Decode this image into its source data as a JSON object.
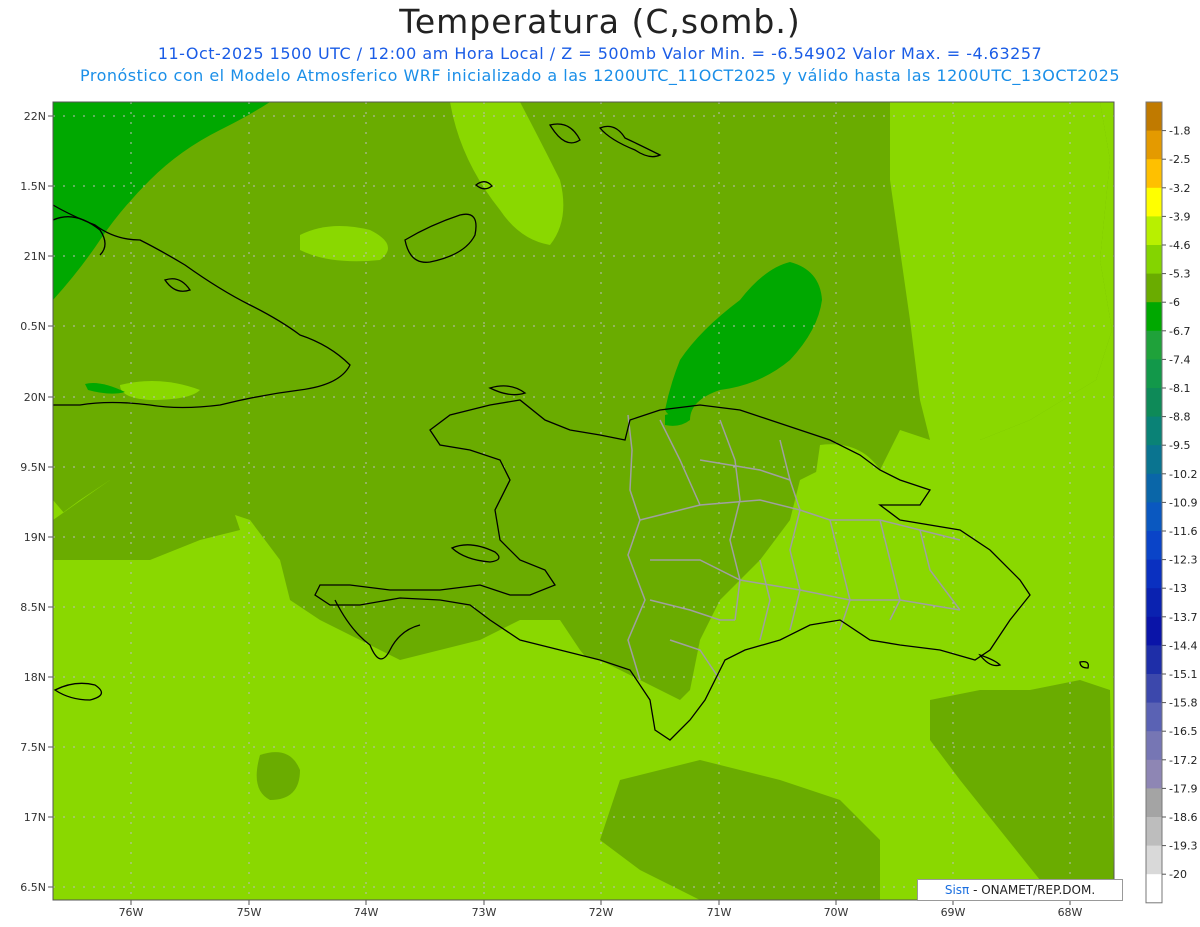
{
  "header": {
    "title": "Temperatura (C,somb.)",
    "line1": "11-Oct-2025  1500 UTC / 12:00 am Hora Local / Z = 500mb  Valor Min. = -6.54902  Valor Max. = -4.63257",
    "line2": "Pronóstico con el Modelo Atmosferico WRF inicializado a las 1200UTC_11OCT2025 y válido hasta las  1200UTC_13OCT2025"
  },
  "axes": {
    "lat_labels": [
      "22N",
      "1.5N",
      "21N",
      "0.5N",
      "20N",
      "9.5N",
      "19N",
      "8.5N",
      "18N",
      "7.5N",
      "17N",
      "6.5N"
    ],
    "lon_labels": [
      "76W",
      "75W",
      "74W",
      "73W",
      "72W",
      "71W",
      "70W",
      "69W",
      "68W"
    ]
  },
  "colorbar": {
    "labels": [
      "-1.8",
      "-2.5",
      "-3.2",
      "-3.9",
      "-4.6",
      "-5.3",
      "-6",
      "-6.7",
      "-7.4",
      "-8.1",
      "-8.8",
      "-9.5",
      "-10.2",
      "-10.9",
      "-11.6",
      "-12.3",
      "-13",
      "-13.7",
      "-14.4",
      "-15.1",
      "-15.8",
      "-16.5",
      "-17.2",
      "-17.9",
      "-18.6",
      "-19.3",
      "-20"
    ],
    "colors": [
      "#c07a00",
      "#e49a00",
      "#ffc000",
      "#ffff00",
      "#b8f000",
      "#84d400",
      "#6aac00",
      "#00a800",
      "#1fa23a",
      "#12984a",
      "#0e8a58",
      "#0a8276",
      "#0a7490",
      "#0a66a8",
      "#0a58c0",
      "#0a44c8",
      "#0a30c0",
      "#0a22b0",
      "#0a14a8",
      "#1e2ea8",
      "#3c48ac",
      "#5a62b4",
      "#7676b4",
      "#8e86b4",
      "#a4a4a4",
      "#bdbdbd",
      "#d9d9d9",
      "#ffffff"
    ]
  },
  "legend_colors": {
    "light_green": "#8ad800",
    "mid_green": "#6aac00",
    "dark_green": "#00a800",
    "coast": "#000000",
    "borders": "#a0a0a0",
    "grid": "#bbbbbb"
  },
  "credit": {
    "sis": "Sisπ",
    "rest": " - ONAMET/REP.DOM."
  }
}
